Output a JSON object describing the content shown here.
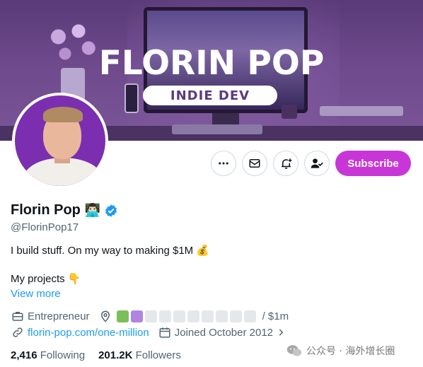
{
  "banner": {
    "title": "FLORIN POP",
    "subtitle": "INDIE DEV"
  },
  "actions": {
    "subscribe_label": "Subscribe",
    "more_icon": "more-horizontal-icon",
    "message_icon": "envelope-icon",
    "notify_icon": "bell-plus-icon",
    "following_icon": "person-check-icon"
  },
  "profile": {
    "name": "Florin Pop",
    "name_emoji": "👨🏻‍💻",
    "handle": "@FlorinPop17",
    "bio_line1": "I build stuff. On my way to making $1M 💰",
    "bio_line2": "My projects 👇",
    "view_more": "View more",
    "occupation": "Entrepreneur",
    "progress_total": 10,
    "progress_filled": 2,
    "progress_colors": [
      "#7cbf5a",
      "#b084e0"
    ],
    "progress_label": "/ $1m",
    "website": "florin-pop.com/one-million",
    "joined": "Joined October 2012",
    "following_count": "2,416",
    "following_label": "Following",
    "followers_count": "201.2K",
    "followers_label": "Followers"
  },
  "watermark": {
    "text": "公众号 · 海外增长圈"
  },
  "colors": {
    "accent": "#1d9bf0",
    "subscribe": "#c936d7",
    "verified": "#1d9bf0"
  }
}
